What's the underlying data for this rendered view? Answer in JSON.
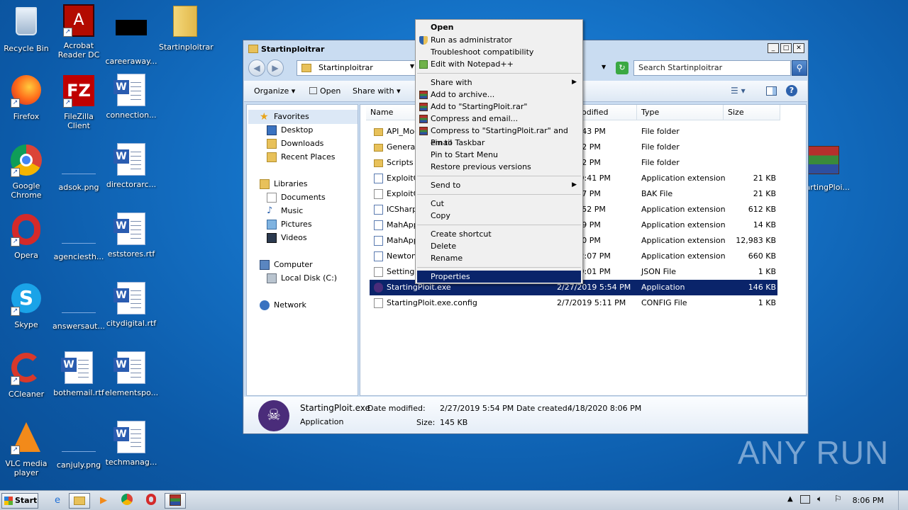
{
  "desktop_icons": [
    {
      "label": "Recycle Bin",
      "icon": "recycle-bin-icon"
    },
    {
      "label": "Acrobat Reader DC",
      "icon": "acrobat-icon"
    },
    {
      "label": "careeraway...",
      "icon": "blank-file-icon"
    },
    {
      "label": "Startinploitrar",
      "icon": "folder-icon"
    },
    {
      "label": "Firefox",
      "icon": "firefox-icon"
    },
    {
      "label": "FileZilla Client",
      "icon": "filezilla-icon"
    },
    {
      "label": "connection...",
      "icon": "word-doc-icon"
    },
    {
      "label": "Google Chrome",
      "icon": "chrome-icon"
    },
    {
      "label": "adsok.png",
      "icon": "image-file-icon"
    },
    {
      "label": "directorarc...",
      "icon": "word-doc-icon"
    },
    {
      "label": "Opera",
      "icon": "opera-icon"
    },
    {
      "label": "agenciesth...",
      "icon": "image-file-icon"
    },
    {
      "label": "eststores.rtf",
      "icon": "word-doc-icon"
    },
    {
      "label": "Skype",
      "icon": "skype-icon"
    },
    {
      "label": "answersaut...",
      "icon": "image-file-icon"
    },
    {
      "label": "citydigital.rtf",
      "icon": "word-doc-icon"
    },
    {
      "label": "CCleaner",
      "icon": "ccleaner-icon"
    },
    {
      "label": "bothemail.rtf",
      "icon": "word-doc-icon"
    },
    {
      "label": "elementspo...",
      "icon": "word-doc-icon"
    },
    {
      "label": "VLC media player",
      "icon": "vlc-icon"
    },
    {
      "label": "canjuly.png",
      "icon": "image-file-icon"
    },
    {
      "label": "techmanag...",
      "icon": "word-doc-icon"
    },
    {
      "label": "StartingPloi...",
      "icon": "winrar-icon"
    }
  ],
  "window": {
    "title": "Startinploitrar",
    "breadcrumb": "Startinploitrar",
    "search_placeholder": "Search Startinploitrar",
    "toolbar": {
      "organize": "Organize",
      "open": "Open",
      "share_with": "Share with"
    },
    "nav": {
      "favorites": "Favorites",
      "desktop": "Desktop",
      "downloads": "Downloads",
      "recent_places": "Recent Places",
      "libraries": "Libraries",
      "documents": "Documents",
      "music": "Music",
      "pictures": "Pictures",
      "videos": "Videos",
      "computer": "Computer",
      "local_disk": "Local Disk (C:)",
      "network": "Network"
    },
    "columns": {
      "name": "Name",
      "date": "odified",
      "type": "Type",
      "size": "Size"
    },
    "files": [
      {
        "name": "API_Moc",
        "date": "019 9:43 PM",
        "type": "File folder",
        "size": "",
        "icon": "folder"
      },
      {
        "name": "Generate",
        "date": "19 6:02 PM",
        "type": "File folder",
        "size": "",
        "icon": "folder"
      },
      {
        "name": "Scripts",
        "date": "19 6:02 PM",
        "type": "File folder",
        "size": "",
        "icon": "folder"
      },
      {
        "name": "ExploitCo",
        "date": "2019 9:41 PM",
        "type": "Application extension",
        "size": "21 KB",
        "icon": "dll"
      },
      {
        "name": "ExploitCo",
        "date": "19 5:47 PM",
        "type": "BAK File",
        "size": "21 KB",
        "icon": "file"
      },
      {
        "name": "ICSharpC",
        "date": "017 4:52 PM",
        "type": "Application extension",
        "size": "612 KB",
        "icon": "dll"
      },
      {
        "name": "MahApps",
        "date": "18 4:39 PM",
        "type": "Application extension",
        "size": "14 KB",
        "icon": "dll"
      },
      {
        "name": "MahApps",
        "date": "18 4:40 PM",
        "type": "Application extension",
        "size": "12,983 KB",
        "icon": "dll"
      },
      {
        "name": "Newtons",
        "date": "018 12:07 PM",
        "type": "Application extension",
        "size": "660 KB",
        "icon": "dll"
      },
      {
        "name": "Settings.",
        "date": "019 10:01 PM",
        "type": "JSON File",
        "size": "1 KB",
        "icon": "file"
      },
      {
        "name": "StartingPloit.exe",
        "date": "2/27/2019 5:54 PM",
        "type": "Application",
        "size": "146 KB",
        "icon": "exe",
        "selected": true
      },
      {
        "name": "StartingPloit.exe.config",
        "date": "2/7/2019 5:11 PM",
        "type": "CONFIG File",
        "size": "1 KB",
        "icon": "file"
      }
    ],
    "details": {
      "filename": "StartingPloit.exe",
      "kind": "Application",
      "date_modified_label": "Date modified:",
      "date_modified": "2/27/2019 5:54 PM",
      "size_label": "Size:",
      "size": "145 KB",
      "date_created_label": "Date created:",
      "date_created": "4/18/2020 8:06 PM"
    }
  },
  "context_menu": [
    {
      "label": "Open",
      "bold": true
    },
    {
      "label": "Run as administrator",
      "icon": "shield"
    },
    {
      "label": "Troubleshoot compatibility"
    },
    {
      "label": "Edit with Notepad++",
      "icon": "npp"
    },
    {
      "sep": true
    },
    {
      "label": "Share with",
      "submenu": true
    },
    {
      "label": "Add to archive...",
      "icon": "rar"
    },
    {
      "label": "Add to \"StartingPloit.rar\"",
      "icon": "rar"
    },
    {
      "label": "Compress and email...",
      "icon": "rar"
    },
    {
      "label": "Compress to \"StartingPloit.rar\" and email",
      "icon": "rar"
    },
    {
      "label": "Pin to Taskbar"
    },
    {
      "label": "Pin to Start Menu"
    },
    {
      "label": "Restore previous versions"
    },
    {
      "sep": true
    },
    {
      "label": "Send to",
      "submenu": true
    },
    {
      "sep": true
    },
    {
      "label": "Cut"
    },
    {
      "label": "Copy"
    },
    {
      "sep": true
    },
    {
      "label": "Create shortcut"
    },
    {
      "label": "Delete"
    },
    {
      "label": "Rename"
    },
    {
      "sep": true
    },
    {
      "label": "Properties",
      "highlighted": true
    }
  ],
  "taskbar": {
    "start": "Start",
    "clock": "8:06 PM"
  },
  "watermark": "ANY RUN"
}
